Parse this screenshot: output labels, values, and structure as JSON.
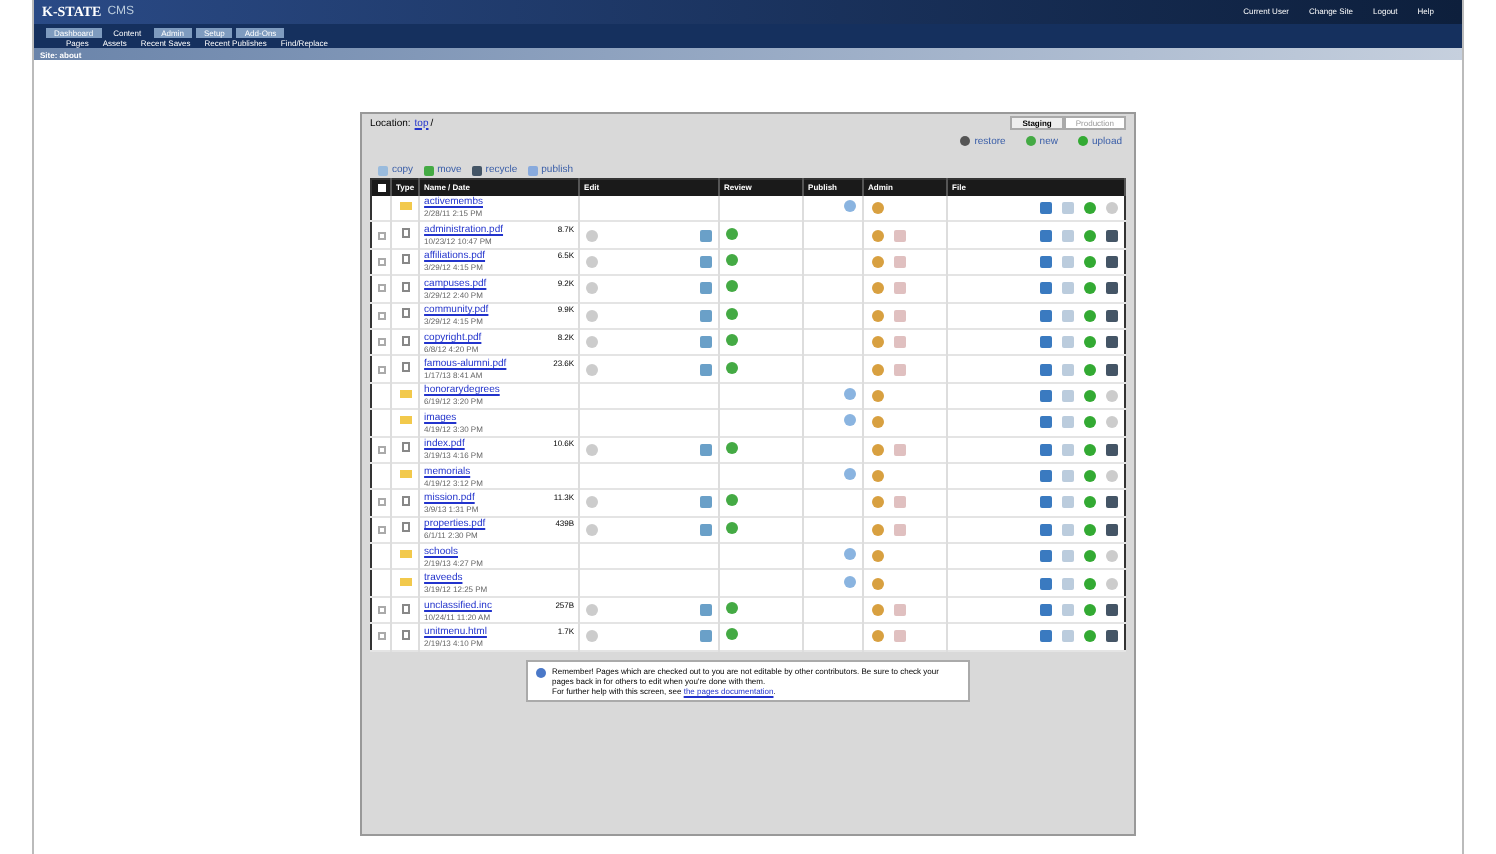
{
  "header": {
    "logo": "K-STATE",
    "product": "CMS",
    "user_links": [
      "Current User",
      "Change Site",
      "Logout",
      "Help"
    ]
  },
  "tabs": [
    {
      "label": "Dashboard",
      "selected": false
    },
    {
      "label": "Content",
      "selected": true
    },
    {
      "label": "Admin",
      "selected": false
    },
    {
      "label": "Setup",
      "selected": false
    },
    {
      "label": "Add-Ons",
      "selected": false
    }
  ],
  "subnav": [
    "Pages",
    "Assets",
    "Recent Saves",
    "Recent Publishes",
    "Find/Replace"
  ],
  "site_bar": "Site: about",
  "location": {
    "label": "Location:",
    "path": "top",
    "suffix": "/"
  },
  "env_tabs": [
    {
      "label": "Staging",
      "selected": true
    },
    {
      "label": "Production",
      "selected": false
    }
  ],
  "actions": [
    "restore",
    "new",
    "upload"
  ],
  "toolbar": [
    "copy",
    "move",
    "recycle",
    "publish"
  ],
  "select_all": {
    "checked": false
  },
  "columns": [
    "Type",
    "Name / Date",
    "Edit",
    "Review",
    "Publish",
    "Admin",
    "File"
  ],
  "rows": [
    {
      "kind": "folder",
      "name": "activemembs",
      "date": "2/28/11 2:15 PM"
    },
    {
      "kind": "file",
      "name": "administration.pdf",
      "date": "10/23/12 10:47 PM",
      "size": "8.7K",
      "checked": false
    },
    {
      "kind": "file",
      "name": "affiliations.pdf",
      "date": "3/29/12 4:15 PM",
      "size": "6.5K",
      "checked": false
    },
    {
      "kind": "file",
      "name": "campuses.pdf",
      "date": "3/29/12 2:40 PM",
      "size": "9.2K",
      "checked": false
    },
    {
      "kind": "file",
      "name": "community.pdf",
      "date": "3/29/12 4:15 PM",
      "size": "9.9K",
      "checked": false
    },
    {
      "kind": "file",
      "name": "copyright.pdf",
      "date": "6/8/12 4:20 PM",
      "size": "8.2K",
      "checked": false
    },
    {
      "kind": "file",
      "name": "famous-alumni.pdf",
      "date": "1/17/13 8:41 AM",
      "size": "23.6K",
      "checked": false
    },
    {
      "kind": "folder",
      "name": "honorarydegrees",
      "date": "6/19/12 3:20 PM"
    },
    {
      "kind": "folder",
      "name": "images",
      "date": "4/19/12 3:30 PM"
    },
    {
      "kind": "file",
      "name": "index.pdf",
      "date": "3/19/13 4:16 PM",
      "size": "10.6K",
      "checked": false
    },
    {
      "kind": "folder",
      "name": "memorials",
      "date": "4/19/12 3:12 PM"
    },
    {
      "kind": "file",
      "name": "mission.pdf",
      "date": "3/9/13 1:31 PM",
      "size": "11.3K",
      "checked": false
    },
    {
      "kind": "file",
      "name": "properties.pdf",
      "date": "6/1/11 2:30 PM",
      "size": "439B",
      "checked": false
    },
    {
      "kind": "folder",
      "name": "schools",
      "date": "2/19/13 4:27 PM"
    },
    {
      "kind": "folder",
      "name": "traveeds",
      "date": "3/19/12 12:25 PM"
    },
    {
      "kind": "file",
      "name": "unclassified.inc",
      "date": "10/24/11 11:20 AM",
      "size": "257B",
      "checked": false
    },
    {
      "kind": "file",
      "name": "unitmenu.html",
      "date": "2/19/13 4:10 PM",
      "size": "1.7K",
      "checked": false
    }
  ],
  "notice": {
    "text": "Remember! Pages which are checked out to you are not editable by other contributors. Be sure to check your pages back in for others to edit when you're done with them.",
    "help": "For further help with this screen, see",
    "link": "the pages documentation",
    "end": "."
  }
}
